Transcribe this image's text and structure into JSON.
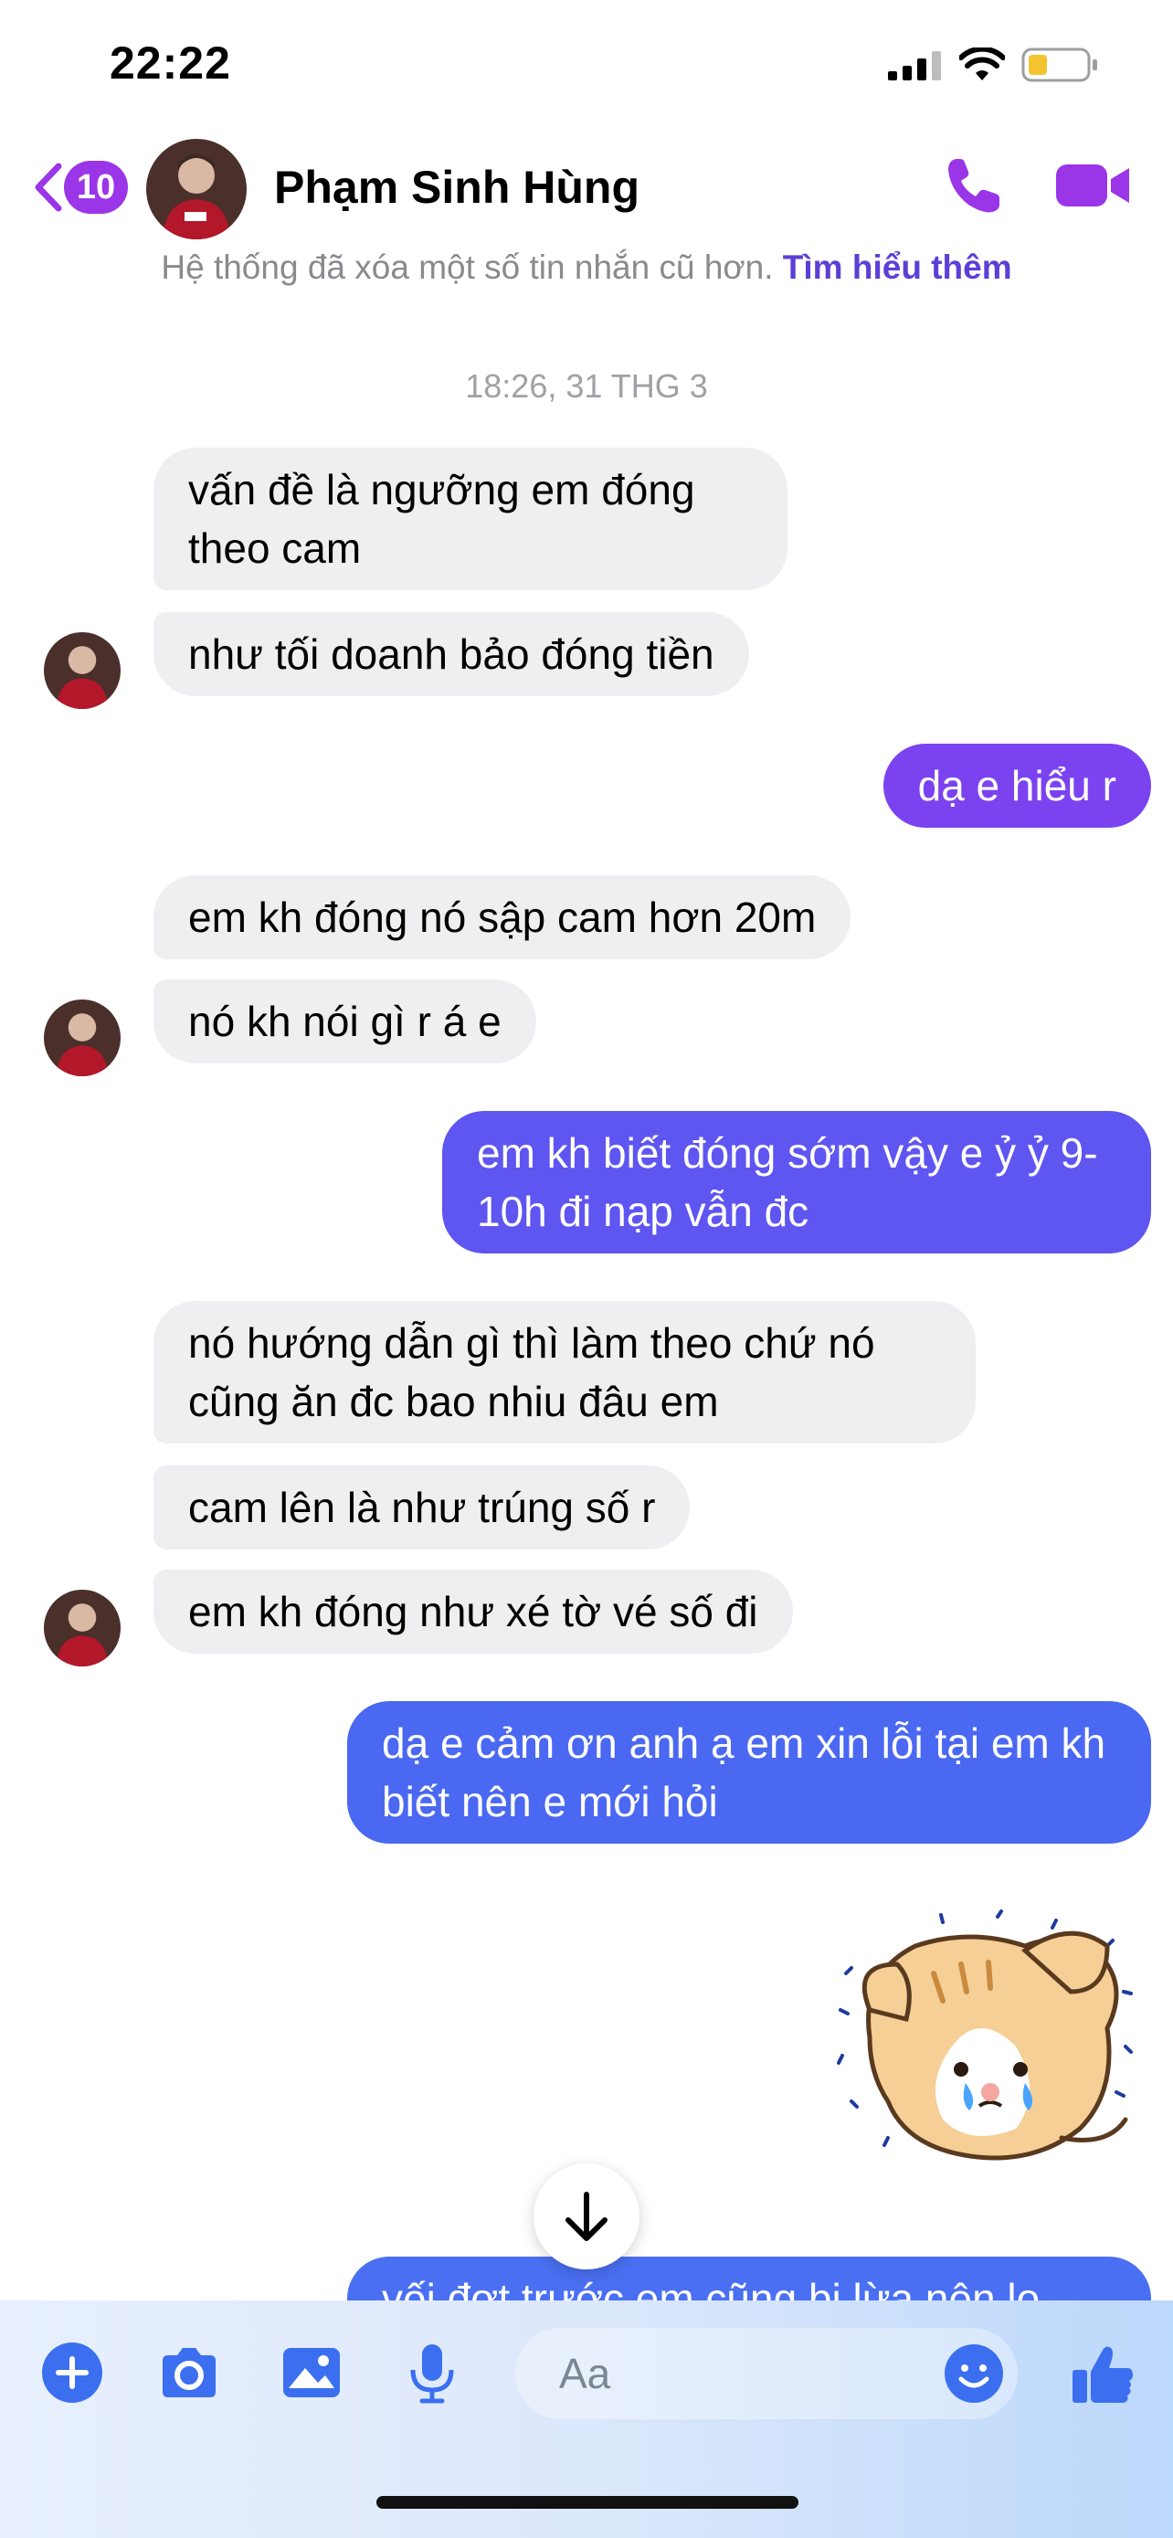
{
  "status_bar": {
    "time": "22:22"
  },
  "header": {
    "back_badge": "10",
    "contact_name": "Phạm Sinh Hùng"
  },
  "notice": {
    "text": "Hệ thống đã xóa một số tin nhắn cũ hơn.",
    "link": "Tìm hiểu thêm"
  },
  "conversation": {
    "timestamp": "18:26, 31 THG 3",
    "messages": [
      {
        "from": "them",
        "text": "vấn đề là ngưỡng em đóng theo cam"
      },
      {
        "from": "them",
        "text": "như tối doanh bảo đóng tiền"
      },
      {
        "from": "me",
        "text": "dạ e hiểu r"
      },
      {
        "from": "them",
        "text": "em kh đóng nó sập cam hơn 20m"
      },
      {
        "from": "them",
        "text": "nó kh nói gì r á e"
      },
      {
        "from": "me",
        "text": "em kh biết đóng sớm vậy e ỷ ỷ 9-10h đi nạp vẫn đc"
      },
      {
        "from": "them",
        "text": "nó hướng dẫn gì thì làm theo chứ nó cũng ăn đc bao nhiu đâu em"
      },
      {
        "from": "them",
        "text": "cam lên là như trúng số r"
      },
      {
        "from": "them",
        "text": "em kh đóng như xé tờ vé số đi"
      },
      {
        "from": "me",
        "text": "dạ e cảm ơn anh ạ em xin lỗi tại em kh biết nên e mới hỏi"
      },
      {
        "from": "me",
        "type": "sticker",
        "icon": "crying-cat-sticker"
      },
      {
        "from": "me",
        "text": "vối đợt trước em cũng bị lừa nên lo"
      }
    ]
  },
  "composer": {
    "placeholder": "Aa",
    "icons": [
      "plus-icon",
      "camera-icon",
      "image-icon",
      "microphone-icon",
      "emoji-icon",
      "thumbs-up-icon"
    ]
  },
  "colors": {
    "accent": "#9a35e8",
    "incoming_bubble": "#efeff1",
    "outgoing_top": "#7b43f0",
    "outgoing_bottom": "#3f6ff2",
    "link": "#5b3fd6"
  }
}
